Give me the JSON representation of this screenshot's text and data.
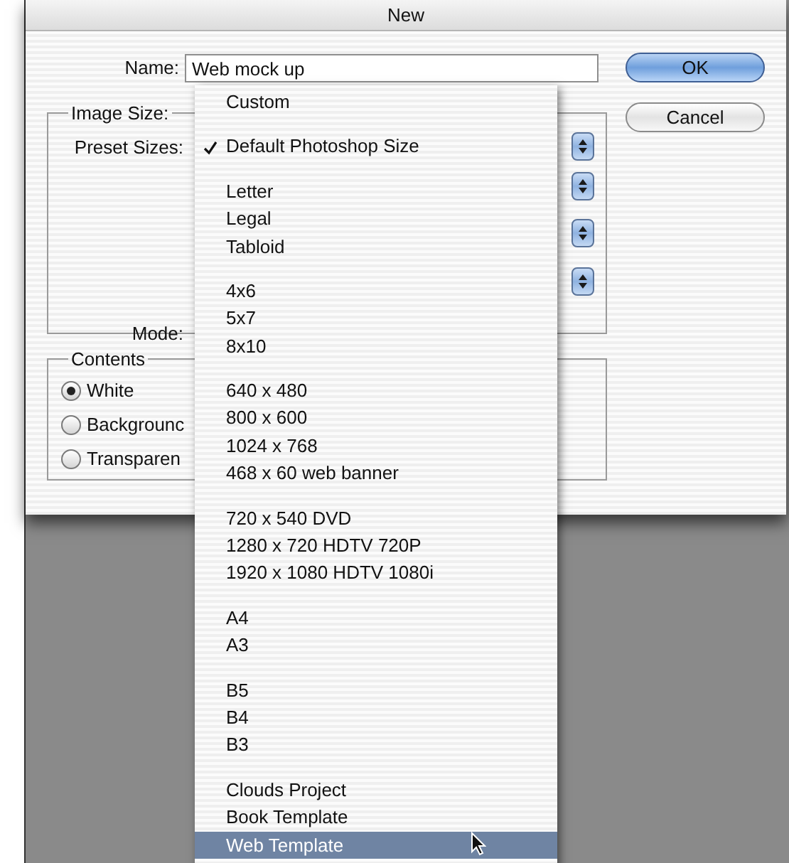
{
  "window": {
    "title": "New"
  },
  "name_field": {
    "label": "Name:",
    "value": "Web mock up"
  },
  "buttons": [
    {
      "label": "OK",
      "default": true
    },
    {
      "label": "Cancel",
      "default": false
    }
  ],
  "image_size": {
    "legend": "Image Size:",
    "preset_label": "Preset Sizes:",
    "mode_label": "Mode:"
  },
  "contents": {
    "legend": "Contents",
    "options": [
      {
        "label": "White",
        "selected": true
      },
      {
        "label": "Backgrounc",
        "selected": false
      },
      {
        "label": "Transparen",
        "selected": false
      }
    ]
  },
  "preset_menu": {
    "groups": [
      {
        "items": [
          {
            "label": "Custom",
            "checked": false,
            "selected": false
          }
        ]
      },
      {
        "items": [
          {
            "label": "Default Photoshop Size",
            "checked": true,
            "selected": false
          }
        ]
      },
      {
        "items": [
          {
            "label": "Letter",
            "checked": false,
            "selected": false
          },
          {
            "label": "Legal",
            "checked": false,
            "selected": false
          },
          {
            "label": "Tabloid",
            "checked": false,
            "selected": false
          }
        ]
      },
      {
        "items": [
          {
            "label": "4x6",
            "checked": false,
            "selected": false
          },
          {
            "label": "5x7",
            "checked": false,
            "selected": false
          },
          {
            "label": "8x10",
            "checked": false,
            "selected": false
          }
        ]
      },
      {
        "items": [
          {
            "label": "640 x 480",
            "checked": false,
            "selected": false
          },
          {
            "label": "800 x 600",
            "checked": false,
            "selected": false
          },
          {
            "label": "1024 x 768",
            "checked": false,
            "selected": false
          },
          {
            "label": "468 x 60 web banner",
            "checked": false,
            "selected": false
          }
        ]
      },
      {
        "items": [
          {
            "label": "720 x 540 DVD",
            "checked": false,
            "selected": false
          },
          {
            "label": "1280 x 720 HDTV 720P",
            "checked": false,
            "selected": false
          },
          {
            "label": "1920 x 1080 HDTV 1080i",
            "checked": false,
            "selected": false
          }
        ]
      },
      {
        "items": [
          {
            "label": "A4",
            "checked": false,
            "selected": false
          },
          {
            "label": "A3",
            "checked": false,
            "selected": false
          }
        ]
      },
      {
        "items": [
          {
            "label": "B5",
            "checked": false,
            "selected": false
          },
          {
            "label": "B4",
            "checked": false,
            "selected": false
          },
          {
            "label": "B3",
            "checked": false,
            "selected": false
          }
        ]
      },
      {
        "items": [
          {
            "label": "Clouds Project",
            "checked": false,
            "selected": false
          },
          {
            "label": "Book Template",
            "checked": false,
            "selected": false
          },
          {
            "label": "Web Template",
            "checked": false,
            "selected": true
          }
        ]
      }
    ]
  }
}
